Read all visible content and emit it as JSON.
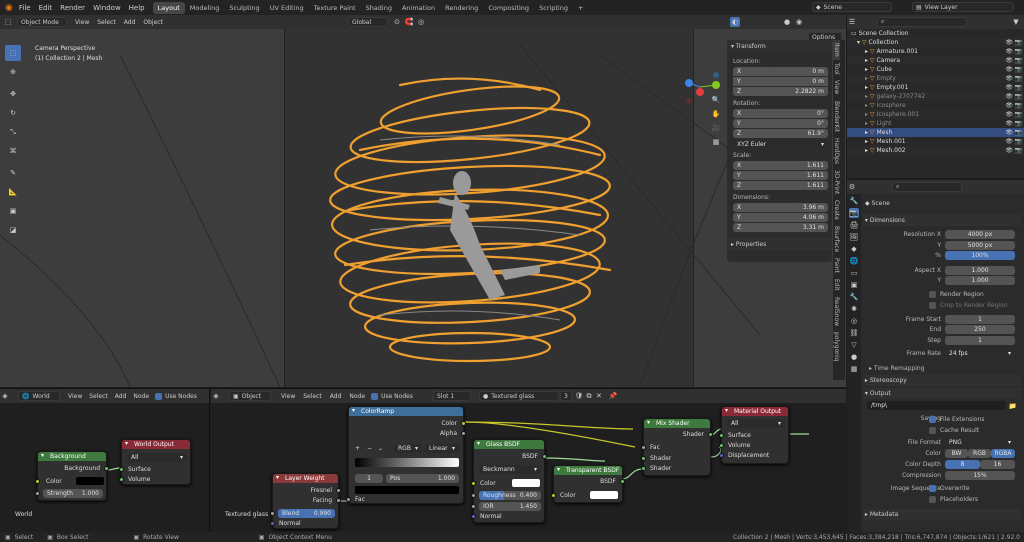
{
  "topbar": {
    "menus": [
      "File",
      "Edit",
      "Render",
      "Window",
      "Help"
    ],
    "workspaces": [
      "Layout",
      "Modeling",
      "Sculpting",
      "UV Editing",
      "Texture Paint",
      "Shading",
      "Animation",
      "Rendering",
      "Compositing",
      "Scripting"
    ],
    "scene": "Scene",
    "view_layer": "View Layer"
  },
  "viewport": {
    "mode": "Object Mode",
    "menus": [
      "View",
      "Select",
      "Add",
      "Object"
    ],
    "transform_orientation": "Global",
    "options": "Options",
    "overlay_title": "Camera Perspective",
    "overlay_sub": "(1) Collection 2 | Mesh"
  },
  "npanel": {
    "transform": "Transform",
    "location": "Location:",
    "rotation": "Rotation:",
    "mode": "XYZ Euler",
    "scale": "Scale:",
    "dimensions": "Dimensions:",
    "properties": "Properties",
    "loc": [
      [
        "X",
        "0 m"
      ],
      [
        "Y",
        "0 m"
      ],
      [
        "Z",
        "2.2822 m"
      ]
    ],
    "rot": [
      [
        "X",
        "0°"
      ],
      [
        "Y",
        "0°"
      ],
      [
        "Z",
        "61.9°"
      ]
    ],
    "scl": [
      [
        "X",
        "1.611"
      ],
      [
        "Y",
        "1.611"
      ],
      [
        "Z",
        "1.611"
      ]
    ],
    "dim": [
      [
        "X",
        "3.96 m"
      ],
      [
        "Y",
        "4.06 m"
      ],
      [
        "Z",
        "3.31 m"
      ]
    ],
    "tabs": [
      "Item",
      "Tool",
      "View",
      "BlenderKit",
      "HardOps",
      "3D-Print",
      "Create",
      "Bsurface",
      "Paint",
      "Edit",
      "RealSnow",
      "polygoniq"
    ]
  },
  "outliner": {
    "title": "Scene Collection",
    "items": [
      {
        "n": "Collection",
        "ind": 0
      },
      {
        "n": "Armature.001",
        "ind": 1
      },
      {
        "n": "Camera",
        "ind": 1
      },
      {
        "n": "Cube",
        "ind": 1
      },
      {
        "n": "Empty",
        "ind": 1
      },
      {
        "n": "Empty.001",
        "ind": 1
      },
      {
        "n": "galaxy-2707742",
        "ind": 1
      },
      {
        "n": "Icosphere",
        "ind": 1
      },
      {
        "n": "Icosphere.001",
        "ind": 1
      },
      {
        "n": "Light",
        "ind": 1
      },
      {
        "n": "Mesh",
        "ind": 1
      },
      {
        "n": "Mesh.001",
        "ind": 1
      },
      {
        "n": "Mesh.002",
        "ind": 1
      }
    ]
  },
  "properties": {
    "scene": "Scene",
    "dimensions": "Dimensions",
    "res_x_l": "Resolution X",
    "res_x": "4000 px",
    "res_y_l": "Y",
    "res_y": "5000 px",
    "pct_l": "%",
    "pct": "100%",
    "asp_x_l": "Aspect X",
    "asp_x": "1.000",
    "asp_y_l": "Y",
    "asp_y": "1.000",
    "render_region": "Render Region",
    "crop": "Crop to Render Region",
    "fs_l": "Frame Start",
    "fs": "1",
    "fe_l": "End",
    "fe": "250",
    "step_l": "Step",
    "step": "1",
    "fr_l": "Frame Rate",
    "fr": "24 fps",
    "time_remap": "Time Remapping",
    "stereo": "Stereoscopy",
    "output": "Output",
    "path": "/tmp\\",
    "saving_l": "Saving",
    "file_ext": "File Extensions",
    "cache": "Cache Result",
    "ff_l": "File Format",
    "ff": "PNG",
    "color_l": "Color",
    "bw": "BW",
    "rgb": "RGB",
    "rgba": "RGBA",
    "cd_l": "Color Depth",
    "cd8": "8",
    "cd16": "16",
    "comp_l": "Compression",
    "comp": "15%",
    "seq_l": "Image Sequence",
    "overwrite": "Overwrite",
    "placeholders": "Placeholders",
    "metadata": "Metadata"
  },
  "world_editor": {
    "type": "World",
    "menus": [
      "View",
      "Select",
      "Add",
      "Node"
    ],
    "use_nodes": "Use Nodes",
    "label": "World",
    "bg_title": "Background",
    "bg_out": "Background",
    "bg_color": "Color",
    "bg_strength_l": "Strength",
    "bg_strength": "1.000",
    "wo_title": "World Output",
    "wo_target": "All",
    "wo_surface": "Surface",
    "wo_volume": "Volume"
  },
  "shader_editor": {
    "type": "Object",
    "menus": [
      "View",
      "Select",
      "Add",
      "Node"
    ],
    "use_nodes": "Use Nodes",
    "slot": "Slot 1",
    "material": "Textured glass",
    "users": "3",
    "label": "Textured glass",
    "cr_title": "ColorRamp",
    "cr_color": "Color",
    "cr_alpha": "Alpha",
    "cr_mode": "RGB",
    "cr_interp": "Linear",
    "cr_idx": "1",
    "cr_pos_l": "Pos",
    "cr_pos": "1.000",
    "cr_fac": "Fac",
    "lw_title": "Layer Weight",
    "lw_fresnel": "Fresnel",
    "lw_facing": "Facing",
    "lw_blend_l": "Blend",
    "lw_blend": "0.990",
    "lw_normal": "Normal",
    "gb_title": "Glass BSDF",
    "gb_bsdf": "BSDF",
    "gb_dist": "Beckmann",
    "gb_color": "Color",
    "gb_rough_l": "Roughness",
    "gb_rough": "0.400",
    "gb_rough_fill": 0.4,
    "gb_ior_l": "IOR",
    "gb_ior": "1.450",
    "gb_normal": "Normal",
    "tb_title": "Transparent BSDF",
    "tb_bsdf": "BSDF",
    "tb_color": "Color",
    "ms_title": "Mix Shader",
    "ms_shader": "Shader",
    "ms_fac": "Fac",
    "ms_s1": "Shader",
    "ms_s2": "Shader",
    "mo_title": "Material Output",
    "mo_target": "All",
    "mo_surface": "Surface",
    "mo_volume": "Volume",
    "mo_disp": "Displacement"
  },
  "status": {
    "select": "Select",
    "box": "Box Select",
    "rotate": "Rotate View",
    "ctx": "Object Context Menu",
    "stats": "Collection 2 | Mesh | Verts:3,453,645 | Faces:3,384,218 | Tris:6,747,874 | Objects:1/621 | 2.92.0"
  },
  "colors": {
    "accent": "#4772b3",
    "selected": "#e87d0d",
    "orange": "#f0a030"
  }
}
